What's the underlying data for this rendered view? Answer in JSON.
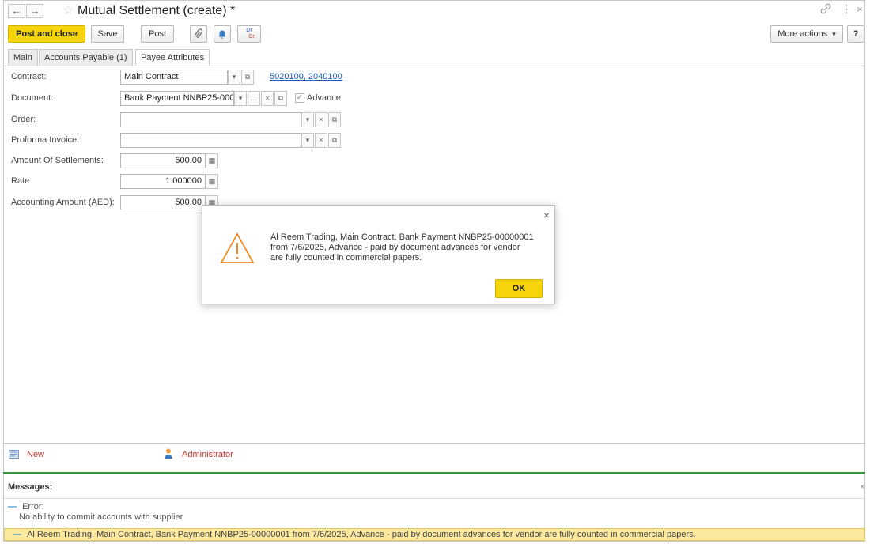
{
  "window": {
    "title": "Mutual Settlement (create) *",
    "back_icon": "←",
    "forward_icon": "→",
    "link_icon": "🔗",
    "menu_icon": "⋮",
    "close_icon": "×"
  },
  "toolbar": {
    "post_and_close": "Post and close",
    "save": "Save",
    "post": "Post",
    "more_actions": "More actions",
    "more_actions_arrow": "▾",
    "help": "?"
  },
  "tabs": [
    {
      "label": "Main"
    },
    {
      "label": "Accounts Payable (1)"
    },
    {
      "label": "Payee Attributes"
    }
  ],
  "form": {
    "contract": {
      "label": "Contract:",
      "value": "Main Contract",
      "link": "5020100, 2040100"
    },
    "document": {
      "label": "Document:",
      "value": "Bank Payment NNBP25-000",
      "advance_label": "Advance",
      "advance_checked": true
    },
    "order": {
      "label": "Order:",
      "value": ""
    },
    "proforma": {
      "label": "Proforma Invoice:",
      "value": ""
    },
    "amount": {
      "label": "Amount Of Settlements:",
      "value": "500.00"
    },
    "rate": {
      "label": "Rate:",
      "value": "1.000000"
    },
    "accounting": {
      "label": "Accounting Amount (AED):",
      "value": "500.00"
    }
  },
  "status": {
    "new_label": "New",
    "user": "Administrator"
  },
  "messages": {
    "title": "Messages:",
    "error_title": "Error:",
    "error_text": "No ability to commit accounts with supplier",
    "highlighted": "Al Reem Trading, Main Contract, Bank Payment NNBP25-00000001 from 7/6/2025, Advance - paid by document advances for vendor are fully counted in commercial papers."
  },
  "dialog": {
    "lines": [
      "Al Reem Trading, Main Contract, Bank Payment NNBP25-00000001",
      "from 7/6/2025, Advance - paid by document advances for vendor",
      "are fully counted in commercial papers."
    ],
    "ok": "OK"
  },
  "colors": {
    "accent_yellow": "#f5d40c",
    "link_blue": "#1a5fb4",
    "status_red": "#c0392b",
    "green_bar": "#2e9c3c",
    "warning_orange": "#f08a24",
    "highlight_yellow": "#fbe9a0"
  },
  "icons": [
    "back-arrow-icon",
    "forward-arrow-icon",
    "star-icon",
    "link-icon",
    "menu-dots-icon",
    "close-icon",
    "paperclip-icon",
    "bell-icon",
    "dr-cr-icon",
    "dropdown-icon",
    "open-icon",
    "clear-icon",
    "ellipsis-icon",
    "calculator-icon",
    "checkmark-icon",
    "document-icon",
    "user-icon",
    "warning-icon"
  ]
}
